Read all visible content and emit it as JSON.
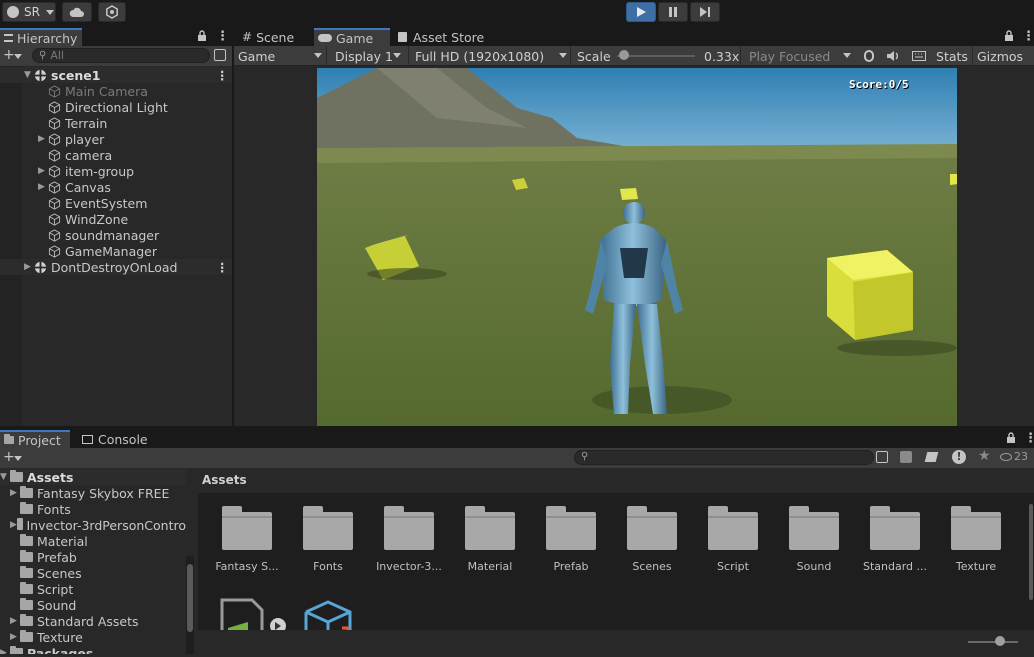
{
  "toolbar": {
    "account_label": "SR",
    "cloud_icon": "cloud-icon",
    "settings_icon": "collab-icon",
    "play_icon": "play-icon",
    "pause_icon": "pause-icon",
    "step_icon": "step-icon"
  },
  "hierarchy": {
    "tab_label": "Hierarchy",
    "search_placeholder": "All",
    "scene_name": "scene1",
    "items": [
      {
        "label": "Main Camera",
        "expandable": false,
        "disabled": true
      },
      {
        "label": "Directional Light",
        "expandable": false,
        "disabled": false
      },
      {
        "label": "Terrain",
        "expandable": false,
        "disabled": false
      },
      {
        "label": "player",
        "expandable": true,
        "disabled": false
      },
      {
        "label": "camera",
        "expandable": false,
        "disabled": false
      },
      {
        "label": "item-group",
        "expandable": true,
        "disabled": false
      },
      {
        "label": "Canvas",
        "expandable": true,
        "disabled": false
      },
      {
        "label": "EventSystem",
        "expandable": false,
        "disabled": false
      },
      {
        "label": "WindZone",
        "expandable": false,
        "disabled": false
      },
      {
        "label": "soundmanager",
        "expandable": false,
        "disabled": false
      },
      {
        "label": "GameManager",
        "expandable": false,
        "disabled": false
      }
    ],
    "dont_destroy": "DontDestroyOnLoad"
  },
  "view_tabs": {
    "scene": "Scene",
    "game": "Game",
    "asset_store": "Asset Store"
  },
  "game_bar": {
    "mode": "Game",
    "display": "Display 1",
    "resolution": "Full HD (1920x1080)",
    "scale_label": "Scale",
    "scale_value": "0.33x",
    "scale_fraction": 0.03,
    "play_mode": "Play Focused",
    "stats": "Stats",
    "gizmos": "Gizmos"
  },
  "game_view": {
    "score_text": "Score:0/5"
  },
  "project": {
    "tab_project": "Project",
    "tab_console": "Console",
    "root": "Assets",
    "breadcrumb": "Assets",
    "tree": [
      {
        "label": "Fantasy Skybox FREE",
        "expandable": true
      },
      {
        "label": "Fonts",
        "expandable": false
      },
      {
        "label": "Invector-3rdPersonContro",
        "expandable": true
      },
      {
        "label": "Material",
        "expandable": false
      },
      {
        "label": "Prefab",
        "expandable": false
      },
      {
        "label": "Scenes",
        "expandable": false
      },
      {
        "label": "Script",
        "expandable": false
      },
      {
        "label": "Sound",
        "expandable": false
      },
      {
        "label": "Standard Assets",
        "expandable": true
      },
      {
        "label": "Texture",
        "expandable": true
      }
    ],
    "packages_label": "Packages",
    "hidden_count": "23",
    "assets": [
      "Fantasy S...",
      "Fonts",
      "Invector-3...",
      "Material",
      "Prefab",
      "Scenes",
      "Script",
      "Sound",
      "Standard ...",
      "Texture"
    ]
  },
  "colors": {
    "accent": "#3a79bb",
    "panel": "#282828",
    "toolbar": "#191919"
  }
}
